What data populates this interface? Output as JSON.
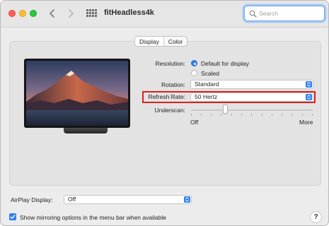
{
  "window": {
    "title": "fitHeadless4k",
    "nav_icons": [
      "chevron-left-icon",
      "chevron-right-icon",
      "grid-icon"
    ]
  },
  "search": {
    "placeholder": "Search",
    "value": ""
  },
  "tabs": [
    {
      "label": "Display",
      "active": true
    },
    {
      "label": "Color",
      "active": false
    }
  ],
  "settings": {
    "resolution": {
      "label": "Resolution:",
      "options": [
        {
          "label": "Default for display",
          "selected": true
        },
        {
          "label": "Scaled",
          "selected": false
        }
      ]
    },
    "rotation": {
      "label": "Rotation:",
      "value": "Standard"
    },
    "refresh_rate": {
      "label": "Refresh Rate:",
      "value": "50 Hertz"
    },
    "underscan": {
      "label": "Underscan:",
      "min_label": "Off",
      "max_label": "More",
      "value_fraction": 0.27
    }
  },
  "airplay": {
    "label": "AirPlay Display:",
    "value": "Off"
  },
  "mirroring": {
    "label": "Show mirroring options in the menu bar when available",
    "checked": true
  },
  "help": {
    "label": "?"
  },
  "colors": {
    "accent": "#2d7ef5",
    "highlight_border": "#e01e1e",
    "search_focus": "#a8c9f4"
  }
}
